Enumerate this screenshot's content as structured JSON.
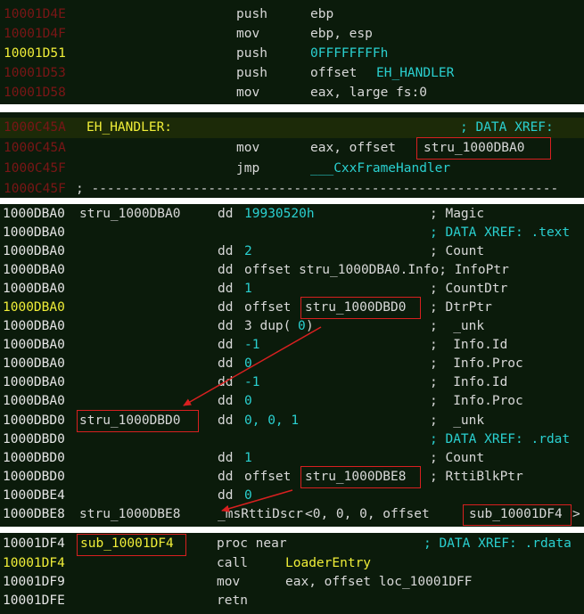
{
  "panel1": {
    "rows": [
      {
        "addr": "10001D4E",
        "mn": "push",
        "ops": "ebp"
      },
      {
        "addr": "10001D4F",
        "mn": "mov",
        "ops": "ebp, esp"
      },
      {
        "addr": "10001D51",
        "mn": "push",
        "ops": "0FFFFFFFFh"
      },
      {
        "addr": "10001D53",
        "mn": "push",
        "ops_prefix": "offset ",
        "ops_sym": "EH_HANDLER"
      },
      {
        "addr": "10001D58",
        "mn": "mov",
        "ops": "eax, large fs:0"
      }
    ]
  },
  "panel2": {
    "rows": [
      {
        "addr": "1000C45A",
        "label": "EH_HANDLER:",
        "comment": "; DATA XREF:"
      },
      {
        "addr": "1000C45A",
        "mn": "mov",
        "ops_prefix": "eax, offset ",
        "ops_sym": "stru_1000DBA0"
      },
      {
        "addr": "1000C45F",
        "mn": "jmp",
        "ops": "___CxxFrameHandler"
      },
      {
        "addr": "1000C45F",
        "sep": "; ------------------------------------------------------------"
      }
    ]
  },
  "panel3": {
    "rows": [
      {
        "addr": "1000DBA0",
        "label": "stru_1000DBA0",
        "dir": "dd",
        "val": "19930520h",
        "comment": "; Magic"
      },
      {
        "addr": "1000DBA0",
        "xref": "; DATA XREF: .text"
      },
      {
        "addr": "1000DBA0",
        "dir": "dd",
        "val": "2",
        "comment": "; Count"
      },
      {
        "addr": "1000DBA0",
        "dir": "dd",
        "val_text": "offset stru_1000DBA0.Info; InfoPtr"
      },
      {
        "addr": "1000DBA0",
        "dir": "dd",
        "val": "1",
        "comment": "; CountDtr"
      },
      {
        "addr": "1000DBA0",
        "dir": "dd",
        "val_text": "offset",
        "val_sym": "stru_1000DBD0",
        "comment": "; DtrPtr"
      },
      {
        "addr": "1000DBA0",
        "dir": "dd",
        "val_pre": "3 dup(",
        "val": "0",
        "val_post": ")",
        "comment": ";  _unk"
      },
      {
        "addr": "1000DBA0",
        "dir": "dd",
        "val": "-1",
        "comment": ";  Info.Id"
      },
      {
        "addr": "1000DBA0",
        "dir": "dd",
        "val": "0",
        "comment": ";  Info.Proc"
      },
      {
        "addr": "1000DBA0",
        "dir": "dd",
        "val": "-1",
        "comment": ";  Info.Id"
      },
      {
        "addr": "1000DBA0",
        "dir": "dd",
        "val": "0",
        "comment": ";  Info.Proc"
      },
      {
        "addr": "1000DBD0",
        "label": "stru_1000DBD0",
        "dir": "dd",
        "val": "0, 0, 1",
        "comment": ";  _unk"
      },
      {
        "addr": "1000DBD0",
        "xref": "; DATA XREF: .rdat"
      },
      {
        "addr": "1000DBD0",
        "dir": "dd",
        "val": "1",
        "comment": "; Count"
      },
      {
        "addr": "1000DBD0",
        "dir": "dd",
        "val_text": "offset",
        "val_sym": "stru_1000DBE8",
        "comment": "; RttiBlkPtr"
      },
      {
        "addr": "1000DBE4",
        "dir": "dd",
        "val": "0"
      },
      {
        "addr": "1000DBE8",
        "label": "stru_1000DBE8",
        "dir": "_msRttiDscr",
        "val_text": "<0, 0, 0, offset",
        "val_sym": "sub_10001DF4",
        "val_post": ">"
      }
    ]
  },
  "panel4": {
    "rows": [
      {
        "addr": "10001DF4",
        "label": "sub_10001DF4",
        "mn": "proc near",
        "comment": "; DATA XREF: .rdata"
      },
      {
        "addr": "10001DF4",
        "mn": "call",
        "ops": "LoaderEntry"
      },
      {
        "addr": "10001DF9",
        "mn": "mov",
        "ops": "eax, offset loc_10001DFF"
      },
      {
        "addr": "10001DFE",
        "mn": "retn"
      }
    ]
  }
}
